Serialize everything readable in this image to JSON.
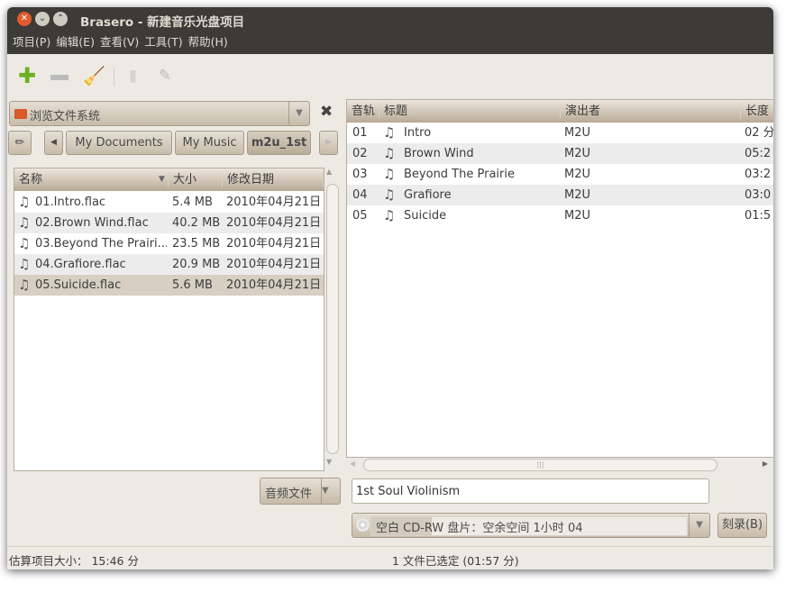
{
  "window": {
    "title": "Brasero - 新建音乐光盘项目"
  },
  "menu": [
    "项目(P)",
    "编辑(E)",
    "查看(V)",
    "工具(T)",
    "帮助(H)"
  ],
  "browser": {
    "source": "浏览文件系统",
    "path": [
      "My Documents",
      "My Music",
      "m2u_1st"
    ],
    "columns": [
      "名称",
      "大小",
      "修改日期"
    ],
    "files": [
      {
        "name": "01.Intro.flac",
        "size": "5.4 MB",
        "date": "2010年04月21日"
      },
      {
        "name": "02.Brown Wind.flac",
        "size": "40.2 MB",
        "date": "2010年04月21日"
      },
      {
        "name": "03.Beyond The Prairi...",
        "size": "23.5 MB",
        "date": "2010年04月21日"
      },
      {
        "name": "04.Grafiore.flac",
        "size": "20.9 MB",
        "date": "2010年04月21日"
      },
      {
        "name": "05.Suicide.flac",
        "size": "5.6 MB",
        "date": "2010年04月21日"
      }
    ],
    "filter": "音频文件"
  },
  "tracks": {
    "columns": [
      "音轨",
      "标题",
      "演出者",
      "长度"
    ],
    "rows": [
      {
        "n": "01",
        "title": "Intro",
        "artist": "M2U",
        "len": "02 分"
      },
      {
        "n": "02",
        "title": "Brown Wind",
        "artist": "M2U",
        "len": "05:2"
      },
      {
        "n": "03",
        "title": "Beyond The Prairie",
        "artist": "M2U",
        "len": "03:2"
      },
      {
        "n": "04",
        "title": "Grafiore",
        "artist": "M2U",
        "len": "03:0"
      },
      {
        "n": "05",
        "title": "Suicide",
        "artist": "M2U",
        "len": "01:5"
      }
    ]
  },
  "disc_title": "1st Soul Violinism",
  "disc": {
    "label": "空白 CD-RW 盘片：空余空间 1小时 04",
    "usage_fraction": 0.19
  },
  "burn_label": "刻录(B)",
  "status": {
    "left": "估算项目大小： 15:46 分",
    "center": "1 文件已选定 (01:57 分)"
  }
}
